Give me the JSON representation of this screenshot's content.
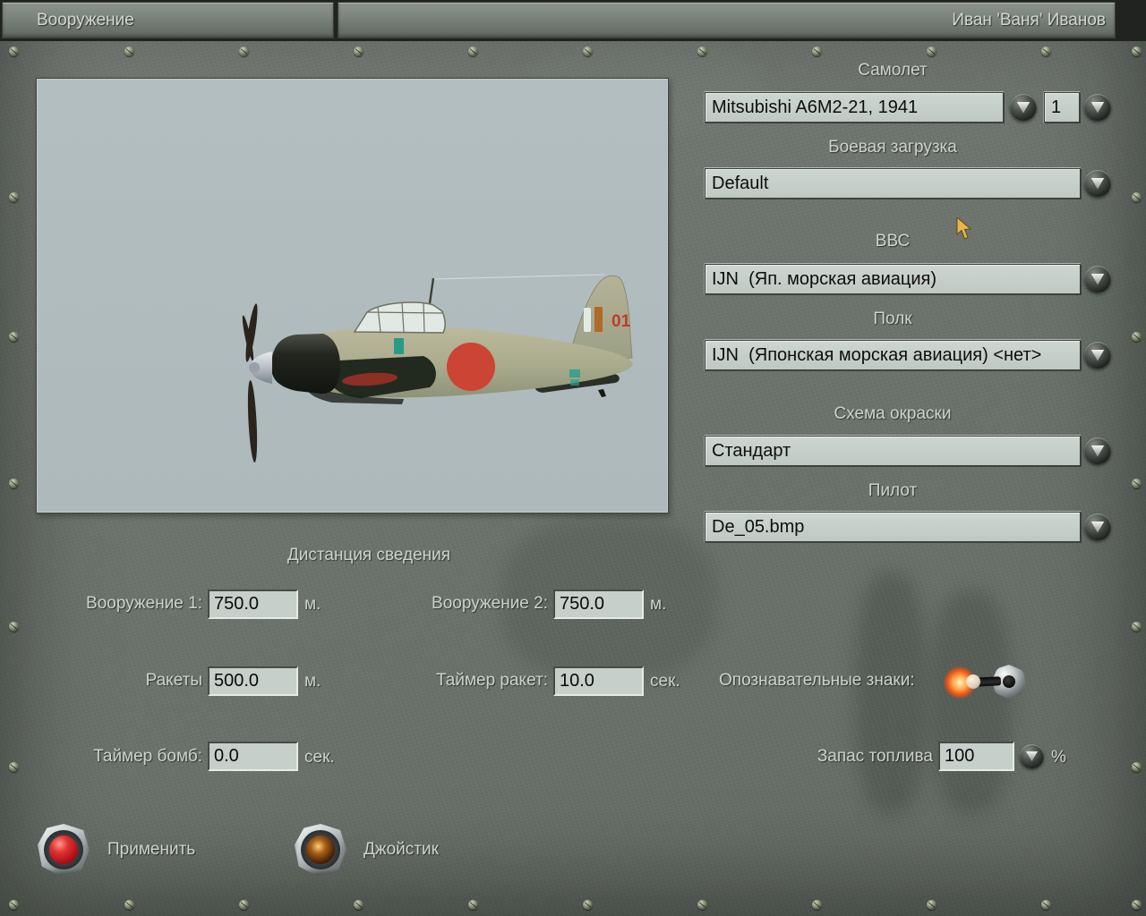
{
  "header": {
    "tab_armament": "Вооружение",
    "pilot_name": "Иван 'Ваня' Иванов"
  },
  "sections": {
    "aircraft": {
      "label": "Самолет",
      "value": "Mitsubishi A6M2-21, 1941",
      "count": "1"
    },
    "loadout": {
      "label": "Боевая загрузка",
      "value": "Default"
    },
    "airforce": {
      "label": "ВВС",
      "value": "IJN  (Яп. морская авиация)"
    },
    "regiment": {
      "label": "Полк",
      "value": "IJN  (Японская морская авиация) <нет>"
    },
    "paint": {
      "label": "Схема окраски",
      "value": "Стандарт"
    },
    "pilot_skin": {
      "label": "Пилот",
      "value": "De_05.bmp"
    }
  },
  "convergence": {
    "title": "Дистанция сведения",
    "weapon1": {
      "label": "Вооружение 1:",
      "value": "750.0",
      "unit": "м."
    },
    "weapon2": {
      "label": "Вооружение 2:",
      "value": "750.0",
      "unit": "м."
    },
    "rockets": {
      "label": "Ракеты",
      "value": "500.0",
      "unit": "м."
    },
    "rocket_timer": {
      "label": "Таймер ракет:",
      "value": "10.0",
      "unit": "сек."
    },
    "bomb_timer": {
      "label": "Таймер бомб:",
      "value": "0.0",
      "unit": "сек."
    }
  },
  "markings": {
    "label": "Опознавательные знаки:",
    "state": "on"
  },
  "fuel": {
    "label": "Запас топлива",
    "value": "100",
    "unit": "%"
  },
  "actions": {
    "apply": "Применить",
    "joystick": "Джойстик"
  },
  "preview": {
    "tail_number": "01"
  },
  "colors": {
    "metal": "#6d736d",
    "field_bg": "#c5cec9",
    "preview_bg": "#b0bbbd",
    "label_text": "#cdd2cd",
    "apply_button": "#c01318",
    "joystick_button": "#5a2d10",
    "toggle_glow": "#f05a18",
    "roundel_red": "#cc4434"
  }
}
